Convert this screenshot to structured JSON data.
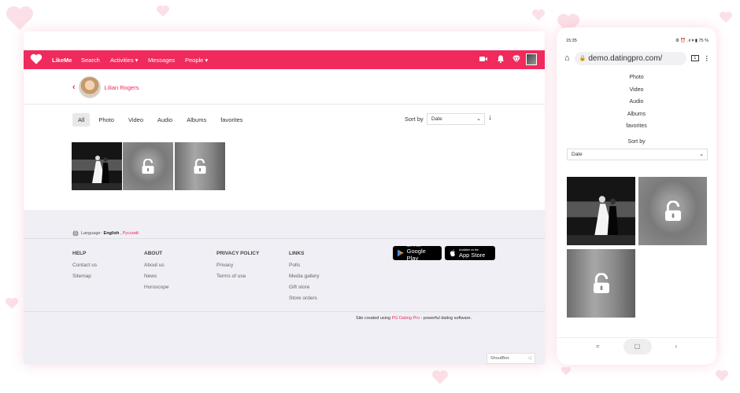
{
  "colors": {
    "brand": "#f02a5c",
    "footer_bg": "#efeff5"
  },
  "topnav": {
    "brand": "LikeMe",
    "items": [
      "Search",
      "Activities ▾",
      "Messages",
      "People ▾"
    ],
    "icons": [
      "video-icon",
      "bell-icon",
      "diamond-icon",
      "user-avatar"
    ]
  },
  "profile": {
    "back_icon": "chevron-left-icon",
    "name": "Lilian Rogers"
  },
  "filters": [
    "All",
    "Photo",
    "Video",
    "Audio",
    "Albums",
    "favorites"
  ],
  "sort": {
    "label": "Sort by",
    "value": "Date",
    "direction_icon": "arrow-down-icon"
  },
  "gallery": [
    {
      "kind": "photo",
      "locked": false
    },
    {
      "kind": "blurred",
      "locked": true
    },
    {
      "kind": "blurred",
      "locked": true
    }
  ],
  "footer": {
    "language_label": "Language:",
    "lang_current": "English",
    "lang_other": "Русский",
    "columns": [
      {
        "title": "HELP",
        "links": [
          "Contact us",
          "Sitemap"
        ]
      },
      {
        "title": "ABOUT",
        "links": [
          "About us",
          "News",
          "Horoscope"
        ]
      },
      {
        "title": "PRIVACY POLICY",
        "links": [
          "Privacy",
          "Terms of use"
        ]
      },
      {
        "title": "LINKS",
        "links": [
          "Polls",
          "Media gallery",
          "Gift store",
          "Store orders"
        ]
      }
    ],
    "google_play": {
      "small": "GET IT ON",
      "big": "Google Play"
    },
    "app_store": {
      "small": "Available on the",
      "big": "App Store"
    },
    "credit_prefix": "Site created using",
    "credit_link": "PG Dating Pro",
    "credit_suffix": "- powerful dating software.",
    "shoutbox": "ShoutBox"
  },
  "mobile": {
    "time": "15:35",
    "battery": "75 %",
    "url": "demo.datingpro.com/",
    "tab_count": "1",
    "menu": [
      "Photo",
      "Video",
      "Audio",
      "Albums",
      "favorites"
    ],
    "sort_label": "Sort by",
    "sort_value": "Date"
  }
}
